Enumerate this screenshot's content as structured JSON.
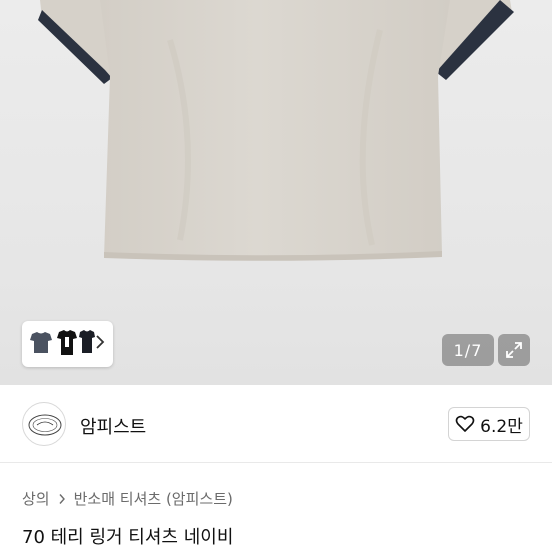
{
  "gallery": {
    "counter": "1/7",
    "expand_icon": "expand-icon",
    "chevron_icon": "chevron-right-icon"
  },
  "seller": {
    "name": "암피스트",
    "avatar_icon": "seller-logo-icon"
  },
  "like": {
    "icon": "heart-outline-icon",
    "count": "6.2만"
  },
  "breadcrumb": {
    "items": [
      "상의",
      "반소매 티셔츠 (암피스트)"
    ],
    "separator_icon": "chevron-right-icon"
  },
  "product": {
    "title": "70 테리 링거 티셔츠 네이비"
  },
  "colors": {
    "shirt_body": "#d9d4cc",
    "shirt_trim": "#2b3240",
    "hero_bg": "#e8e8e8",
    "overlay": "#8a8a8a"
  }
}
